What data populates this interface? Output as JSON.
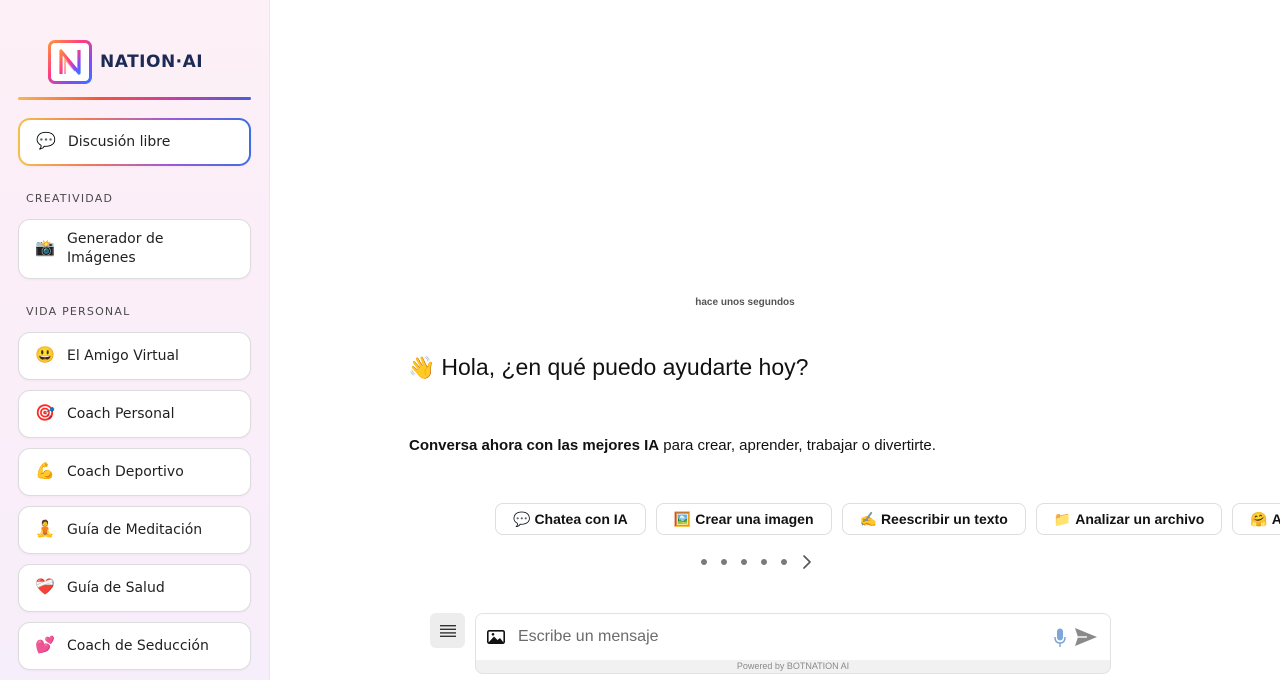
{
  "brand": {
    "name": "NATION·AI"
  },
  "sidebar": {
    "free_chat": {
      "emoji": "💬",
      "label": "Discusión libre"
    },
    "sections": [
      {
        "title": "CREATIVIDAD",
        "items": [
          {
            "emoji": "📸",
            "label": "Generador de Imágenes"
          }
        ]
      },
      {
        "title": "VIDA PERSONAL",
        "items": [
          {
            "emoji": "😃",
            "label": "El Amigo Virtual"
          },
          {
            "emoji": "🎯",
            "label": "Coach Personal"
          },
          {
            "emoji": "💪",
            "label": "Coach Deportivo"
          },
          {
            "emoji": "🧘",
            "label": "Guía de Meditación"
          },
          {
            "emoji": "❤️‍🩹",
            "label": "Guía de Salud"
          },
          {
            "emoji": "💕",
            "label": "Coach de Seducción"
          }
        ]
      }
    ]
  },
  "chat": {
    "timestamp": "hace unos segundos",
    "greeting_emoji": "👋",
    "greeting": "Hola, ¿en qué puedo ayudarte hoy?",
    "subtitle_bold": "Conversa ahora con las mejores IA",
    "subtitle_rest": " para crear, aprender, trabajar o divertirte."
  },
  "suggestions": [
    {
      "emoji": "💬",
      "label": "Chatea con IA"
    },
    {
      "emoji": "🖼️",
      "label": "Crear una imagen"
    },
    {
      "emoji": "✍️",
      "label": "Reescribir un texto"
    },
    {
      "emoji": "📁",
      "label": "Analizar un archivo"
    },
    {
      "emoji": "🤗",
      "label": "Ami"
    }
  ],
  "carousel": {
    "page_count": 5
  },
  "composer": {
    "placeholder": "Escribe un mensaje",
    "value": "",
    "powered_by": "Powered by BOTNATION AI"
  },
  "icons": {
    "logo": "n-logo-icon",
    "menu": "hamburger-menu-icon",
    "image_upload": "image-upload-icon",
    "mic": "microphone-icon",
    "send": "send-icon",
    "next": "chevron-right-icon"
  },
  "colors": {
    "accent_orange": "#f7b84a",
    "accent_pink": "#f5533d",
    "accent_purple": "#c93fa0",
    "accent_blue": "#4a5dd8",
    "mic_blue": "#7fa6d9"
  }
}
